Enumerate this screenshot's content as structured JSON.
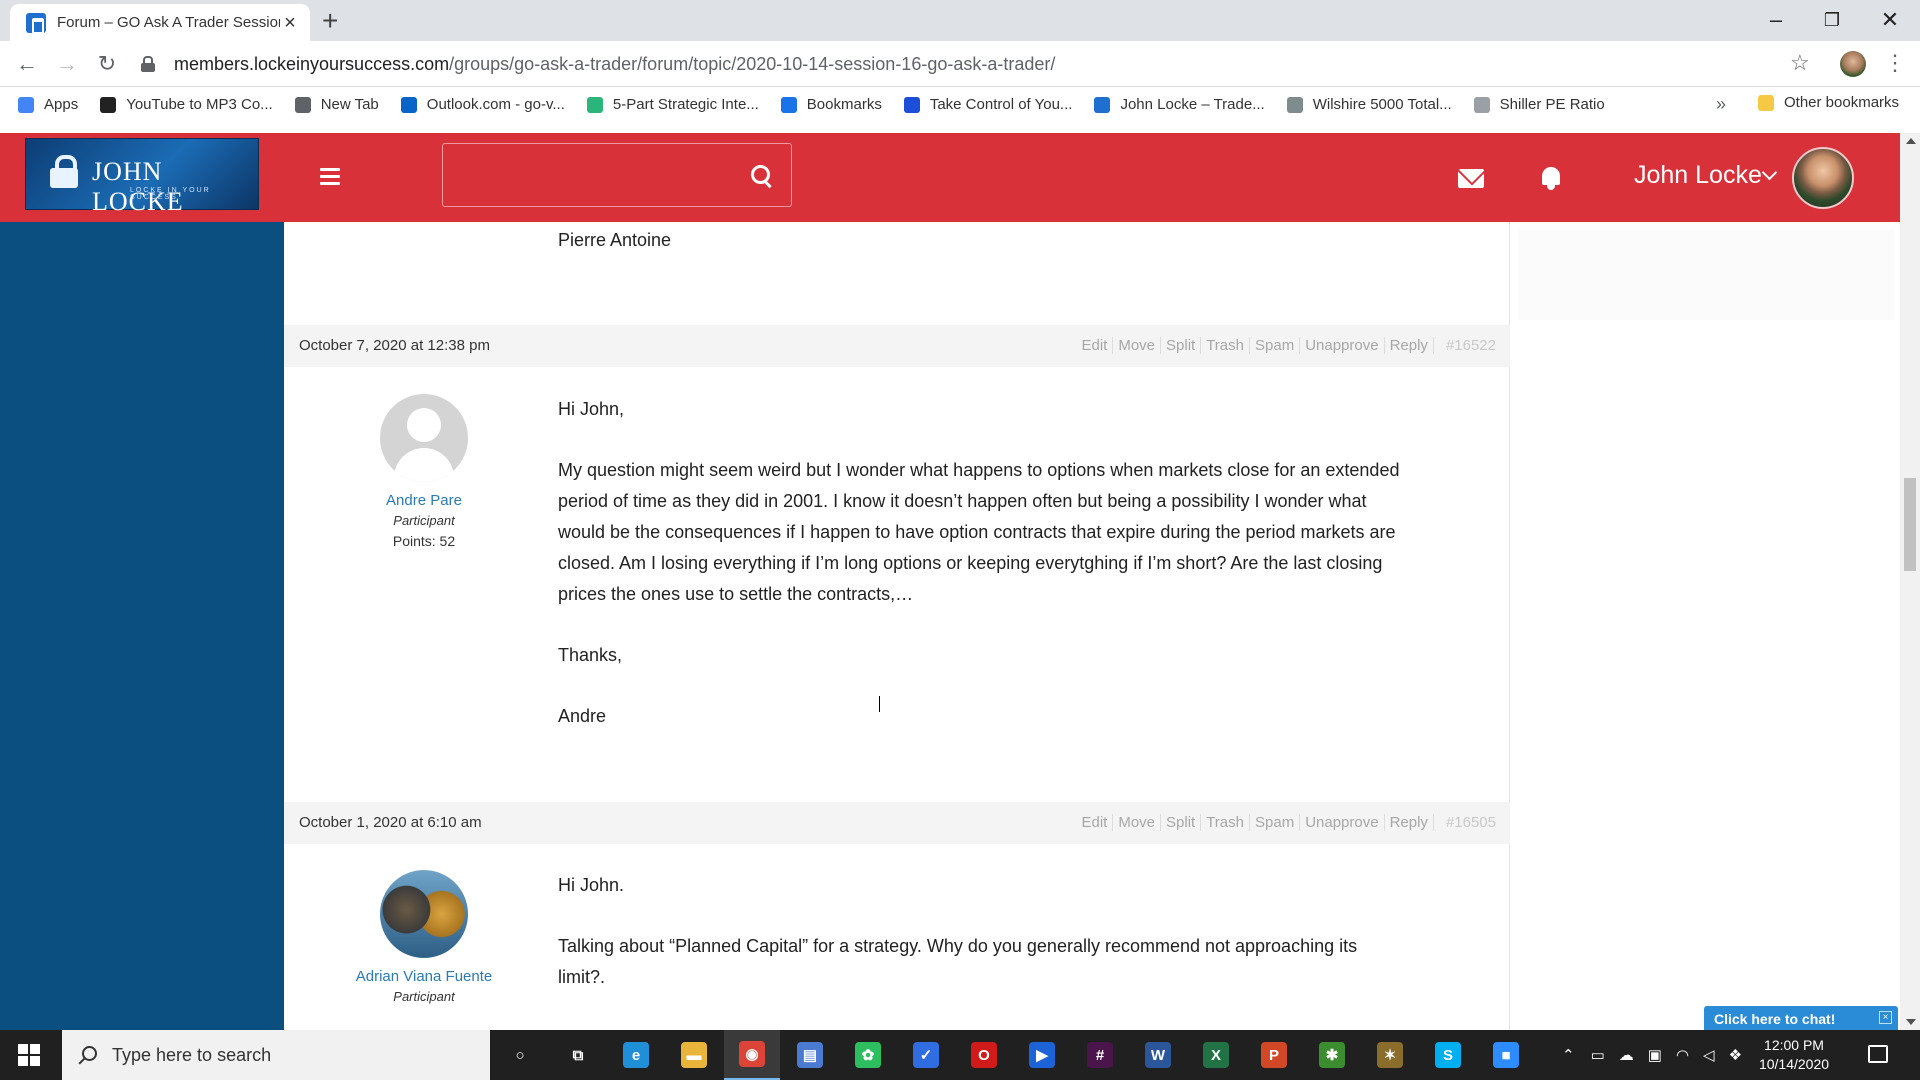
{
  "browser": {
    "tab_title": "Forum – GO Ask A Trader Session",
    "url_host": "members.lockeinyoursuccess.com",
    "url_path": "/groups/go-ask-a-trader/forum/topic/2020-10-14-session-16-go-ask-a-trader/",
    "bookmarks": [
      {
        "label": "Apps",
        "icon": "apps-grid-icon",
        "color": "#4285f4"
      },
      {
        "label": "YouTube to MP3 Co...",
        "icon": "music-note-icon",
        "color": "#222222"
      },
      {
        "label": "New Tab",
        "icon": "globe-icon",
        "color": "#5f6368"
      },
      {
        "label": "Outlook.com - go-v...",
        "icon": "outlook-icon",
        "color": "#0a64c8"
      },
      {
        "label": "5-Part Strategic Inte...",
        "icon": "circle-logo-icon",
        "color": "#2bb57a"
      },
      {
        "label": "Bookmarks",
        "icon": "star-icon",
        "color": "#1a73e8"
      },
      {
        "label": "Take Control of You...",
        "icon": "round-logo-icon",
        "color": "#1d4ed8"
      },
      {
        "label": "John Locke – Trade...",
        "icon": "lock-logo-icon",
        "color": "#1f6fd1"
      },
      {
        "label": "Wilshire 5000 Total...",
        "icon": "chart-icon",
        "color": "#7f8c8d"
      },
      {
        "label": "Shiller PE Ratio",
        "icon": "loading-icon",
        "color": "#9aa0a6"
      }
    ],
    "bookmarks_more": "»",
    "other_bookmarks": "Other bookmarks"
  },
  "site": {
    "logo_name": "JOHN LOCKE",
    "logo_tagline": "LOCKE IN YOUR SUCCESS",
    "search_placeholder": "",
    "user_name": "John Locke"
  },
  "thread": {
    "previous_signoff": "Pierre Antoine",
    "actions": [
      "Edit",
      "Move",
      "Split",
      "Trash",
      "Spam",
      "Unapprove",
      "Reply"
    ],
    "posts": [
      {
        "date": "October 7, 2020 at 12:38 pm",
        "post_id": "#16522",
        "author": "Andre Pare",
        "role": "Participant",
        "points": "Points: 52",
        "paragraphs": [
          "Hi John,",
          "My question might seem weird but I wonder what happens to options when markets close for an extended period of time as they did in 2001. I know it doesn’t happen often but being a possibility I wonder what would be the consequences if I happen to have option contracts that expire during the period markets are closed. Am I losing everything if I’m long options or keeping everytghing if I’m short? Are the last closing prices the ones use to settle the contracts,…",
          "Thanks,",
          "Andre"
        ]
      },
      {
        "date": "October 1, 2020 at 6:10 am",
        "post_id": "#16505",
        "author": "Adrian Viana Fuente",
        "role": "Participant",
        "paragraphs": [
          "Hi John.",
          "Talking about “Planned Capital” for a strategy. Why do you generally recommend not approaching its limit?."
        ]
      }
    ]
  },
  "chat": {
    "label": "Click here to chat!",
    "close": "×"
  },
  "taskbar": {
    "search_placeholder": "Type here to search",
    "apps": [
      {
        "name": "cortana-icon",
        "glyph": "○",
        "color": "transparent"
      },
      {
        "name": "task-view-icon",
        "glyph": "⧉",
        "color": "transparent"
      },
      {
        "name": "edge-icon",
        "glyph": "e",
        "color": "#1f8fd8"
      },
      {
        "name": "file-explorer-icon",
        "glyph": "▬",
        "color": "#e8b53a"
      },
      {
        "name": "chrome-icon",
        "glyph": "◉",
        "color": "#db4437"
      },
      {
        "name": "notebook-icon",
        "glyph": "▤",
        "color": "#4a7bd1"
      },
      {
        "name": "evernote-icon",
        "glyph": "✿",
        "color": "#2dbe60"
      },
      {
        "name": "todo-icon",
        "glyph": "✓",
        "color": "#2f6de1"
      },
      {
        "name": "opera-icon",
        "glyph": "O",
        "color": "#d11a1a"
      },
      {
        "name": "media-player-icon",
        "glyph": "▶",
        "color": "#1b63d6"
      },
      {
        "name": "slack-icon",
        "glyph": "#",
        "color": "#4a154b"
      },
      {
        "name": "word-icon",
        "glyph": "W",
        "color": "#2b579a"
      },
      {
        "name": "excel-icon",
        "glyph": "X",
        "color": "#217346"
      },
      {
        "name": "powerpoint-icon",
        "glyph": "P",
        "color": "#d24726"
      },
      {
        "name": "trading-app-icon",
        "glyph": "✱",
        "color": "#3c8d2f"
      },
      {
        "name": "tools-app-icon",
        "glyph": "✶",
        "color": "#8a6d2b"
      },
      {
        "name": "skype-icon",
        "glyph": "S",
        "color": "#00aff0"
      },
      {
        "name": "zoom-icon",
        "glyph": "■",
        "color": "#2d8cff"
      }
    ],
    "time": "12:00 PM",
    "date": "10/14/2020"
  }
}
